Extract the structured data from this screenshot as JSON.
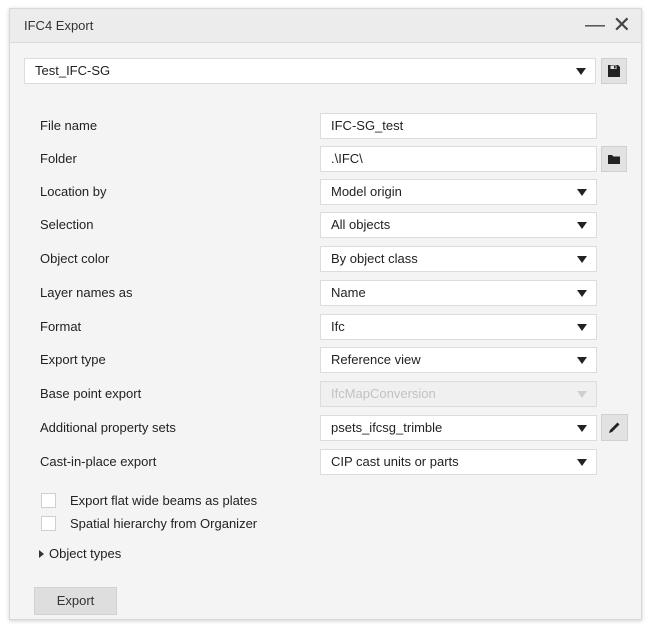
{
  "window": {
    "title": "IFC4 Export",
    "minimize_glyph": "—",
    "close_glyph": "✕"
  },
  "preset": {
    "value": "Test_IFC-SG",
    "save_icon": "save-icon"
  },
  "fields": {
    "file_name": {
      "label": "File name",
      "value": "IFC-SG_test"
    },
    "folder": {
      "label": "Folder",
      "value": ".\\IFC\\"
    },
    "location_by": {
      "label": "Location by",
      "value": "Model origin"
    },
    "selection": {
      "label": "Selection",
      "value": "All objects"
    },
    "object_color": {
      "label": "Object color",
      "value": "By object class"
    },
    "layer_names_as": {
      "label": "Layer names as",
      "value": "Name"
    },
    "format": {
      "label": "Format",
      "value": "Ifc"
    },
    "export_type": {
      "label": "Export type",
      "value": "Reference view"
    },
    "base_point_export": {
      "label": "Base point export",
      "value": "IfcMapConversion",
      "disabled": true
    },
    "additional_property_sets": {
      "label": "Additional property sets",
      "value": "psets_ifcsg_trimble"
    },
    "cast_in_place_export": {
      "label": "Cast-in-place export",
      "value": "CIP cast units or parts"
    }
  },
  "checkboxes": {
    "flat_wide_beams": {
      "label": "Export flat wide beams as plates",
      "checked": false
    },
    "spatial_hierarchy": {
      "label": "Spatial hierarchy from Organizer",
      "checked": false
    }
  },
  "object_types_label": "Object types",
  "export_button": "Export",
  "colors": {
    "window_bg": "#f4f4f4",
    "field_bg": "#ffffff",
    "button_bg": "#dedede",
    "disabled_text": "#c2c2c2"
  }
}
